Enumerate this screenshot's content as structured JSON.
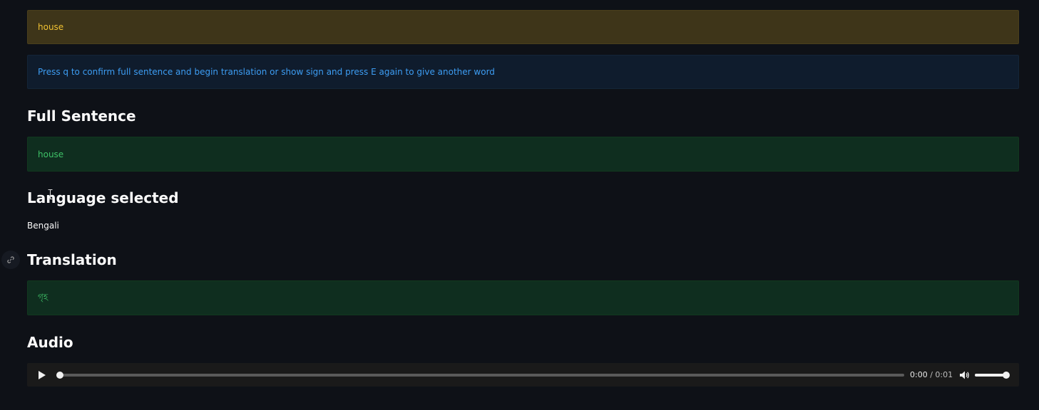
{
  "alerts": {
    "warning_text": "house",
    "info_text": "Press q to confirm full sentence and begin translation or show sign and press E again to give another word"
  },
  "full_sentence": {
    "heading": "Full Sentence",
    "value": "house"
  },
  "language": {
    "heading": "Language selected",
    "value": "Bengali"
  },
  "translation": {
    "heading": "Translation",
    "value": "গৃহ"
  },
  "audio": {
    "heading": "Audio",
    "current_time": "0:00",
    "separator": " / ",
    "duration": "0:01",
    "progress_fraction": 0.0,
    "volume_fraction": 1.0,
    "icons": {
      "play": "play-icon",
      "volume": "volume-icon"
    }
  },
  "icons": {
    "anchor": "link-icon"
  },
  "colors": {
    "background": "#0e1117",
    "warning_text": "#f1c232",
    "info_text": "#3d9df3",
    "success_text": "#3ec267"
  }
}
